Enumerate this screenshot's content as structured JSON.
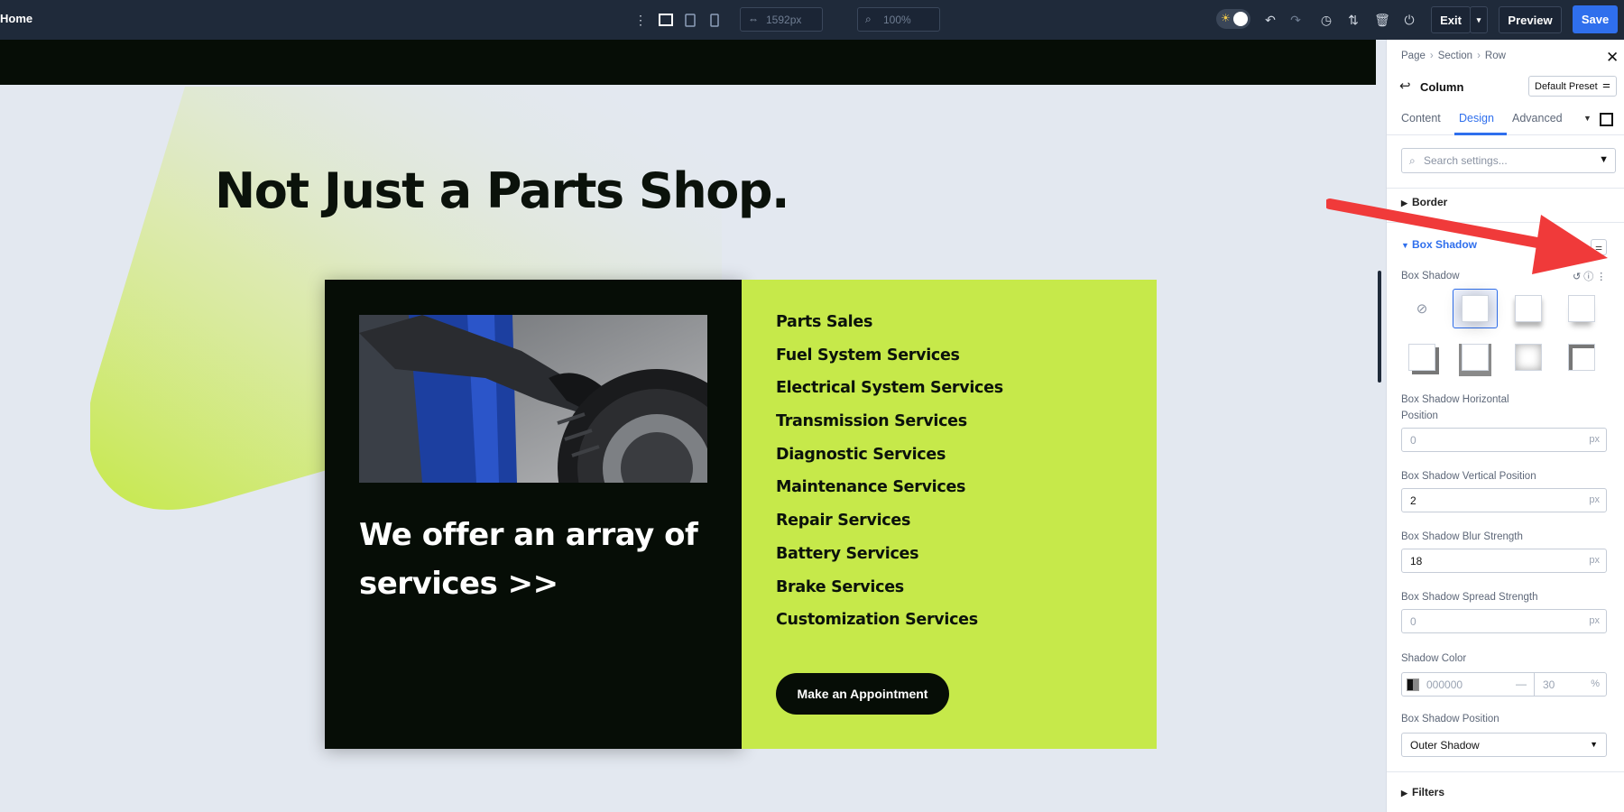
{
  "toolbar": {
    "home_label": "Home",
    "width_value": "1592px",
    "zoom_value": "100%",
    "exit_label": "Exit",
    "preview_label": "Preview",
    "save_label": "Save",
    "colors": {
      "bg": "#1f2a3a",
      "save": "#2f6fed"
    }
  },
  "canvas": {
    "headline": "Not Just a Parts Shop.",
    "tagline": "We offer an array of services >>",
    "services": [
      "Parts Sales",
      "Fuel System Services",
      "Electrical System Services",
      "Transmission Services",
      "Diagnostic Services",
      "Maintenance Services",
      "Repair Services",
      "Battery Services",
      "Brake Services",
      "Customization Services"
    ],
    "cta_label": "Make an Appointment",
    "colors": {
      "dark": "#060d06",
      "lime": "#c6e94a",
      "background": "#e3e8f0"
    }
  },
  "panel": {
    "breadcrumbs": [
      "Page",
      "Section",
      "Row"
    ],
    "module_title": "Column",
    "preset_label": "Default Preset",
    "tabs": [
      "Content",
      "Design",
      "Advanced"
    ],
    "active_tab": "Design",
    "search_placeholder": "Search settings...",
    "groups": {
      "border": "Border",
      "box_shadow": "Box Shadow",
      "filters": "Filters"
    },
    "box_shadow_label": "Box Shadow",
    "fields": {
      "horizontal": {
        "label": "Box Shadow Horizontal Position",
        "placeholder": "0",
        "unit": "px"
      },
      "vertical": {
        "label": "Box Shadow Vertical Position",
        "value": "2",
        "unit": "px"
      },
      "blur": {
        "label": "Box Shadow Blur Strength",
        "value": "18",
        "unit": "px"
      },
      "spread": {
        "label": "Box Shadow Spread Strength",
        "placeholder": "0",
        "unit": "px"
      },
      "color": {
        "label": "Shadow Color",
        "hex_placeholder": "000000",
        "dash": "—",
        "opacity_placeholder": "30",
        "unit": "%"
      },
      "position": {
        "label": "Box Shadow Position",
        "value": "Outer Shadow"
      }
    }
  }
}
